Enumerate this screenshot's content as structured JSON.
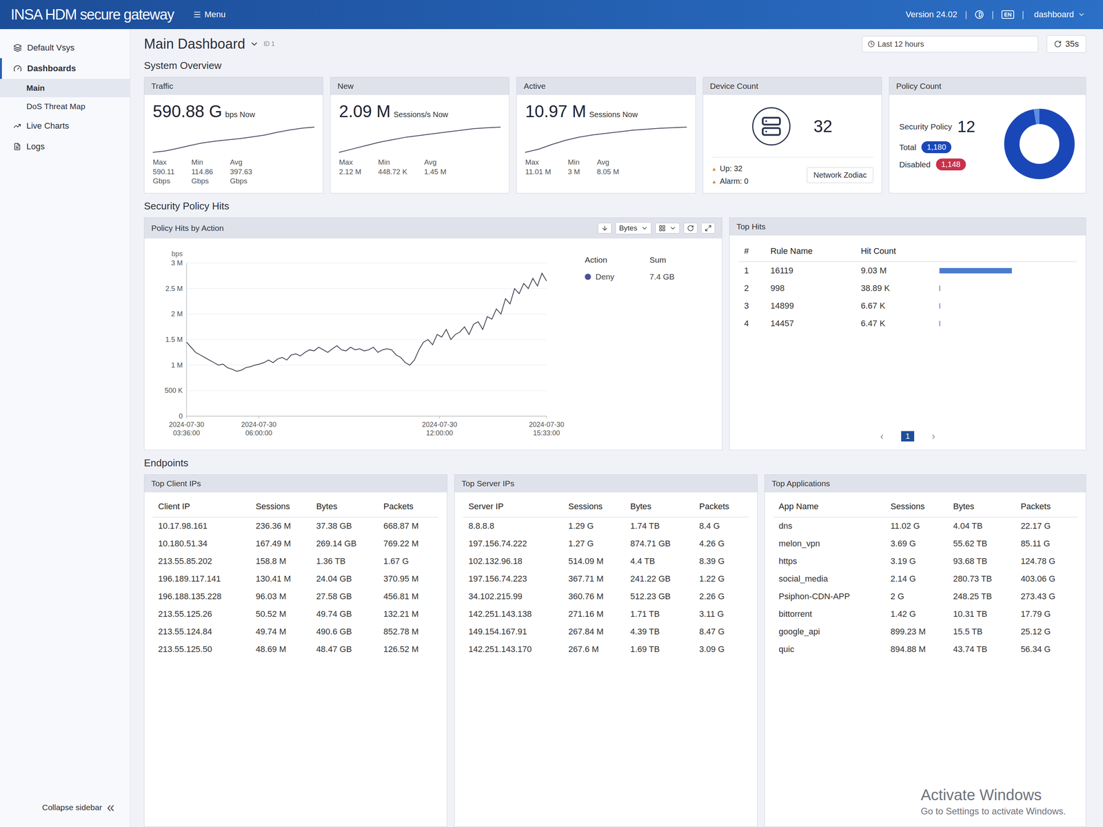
{
  "topbar": {
    "logo": "INSA HDM secure gateway",
    "menu": "Menu",
    "version": "Version 24.02",
    "separator": "|",
    "lang": "EN",
    "user": "dashboard"
  },
  "sidebar": {
    "vsys": "Default Vsys",
    "group": {
      "label": "Dashboards",
      "expanded": true,
      "children": [
        {
          "label": "Main",
          "selected": true
        },
        {
          "label": "DoS Threat Map",
          "selected": false
        }
      ]
    },
    "items": [
      {
        "label": "Live Charts",
        "selected": false
      },
      {
        "label": "Logs",
        "selected": false
      }
    ],
    "collapse": "Collapse sidebar",
    "collapse_glyph": "«"
  },
  "header": {
    "title": "Main Dashboard",
    "id": "ID 1",
    "time_range": "Last 12 hours",
    "refresh": "35s"
  },
  "overview": {
    "title": "System Overview",
    "cards": [
      {
        "title": "Traffic",
        "value": "590.88 G",
        "unit": "bps Now",
        "series": [
          150,
          175,
          220,
          270,
          315,
          345,
          368,
          390,
          420,
          452,
          500,
          540,
          572,
          590
        ],
        "stats": [
          {
            "label": "Max",
            "value": "590.11",
            "unit": "Gbps"
          },
          {
            "label": "Min",
            "value": "114.86",
            "unit": "Gbps"
          },
          {
            "label": "Avg",
            "value": "397.63",
            "unit": "Gbps"
          }
        ]
      },
      {
        "title": "New",
        "value": "2.09 M",
        "unit": "Sessions/s Now",
        "series": [
          0.6,
          0.8,
          1.0,
          1.2,
          1.35,
          1.5,
          1.6,
          1.7,
          1.8,
          1.9,
          2.0,
          2.05,
          2.09
        ],
        "stats": [
          {
            "label": "Max",
            "value": "2.12 M",
            "unit": ""
          },
          {
            "label": "Min",
            "value": "448.72 K",
            "unit": ""
          },
          {
            "label": "Avg",
            "value": "1.45 M",
            "unit": ""
          }
        ]
      },
      {
        "title": "Active",
        "value": "10.97 M",
        "unit": "Sessions Now",
        "series": [
          3,
          4,
          5.5,
          6.8,
          7.8,
          8.5,
          9,
          9.5,
          10,
          10.3,
          10.6,
          10.8,
          10.97
        ],
        "stats": [
          {
            "label": "Max",
            "value": "11.01 M",
            "unit": ""
          },
          {
            "label": "Min",
            "value": "3 M",
            "unit": ""
          },
          {
            "label": "Avg",
            "value": "8.05 M",
            "unit": ""
          }
        ]
      }
    ],
    "device": {
      "title": "Device Count",
      "count": "32",
      "up": {
        "glyph": "▲",
        "label": "Up: 32"
      },
      "alarm": {
        "glyph": "▲",
        "label": "Alarm: 0"
      },
      "button": "Network Zodiac"
    },
    "policy": {
      "title": "Policy Count",
      "label": "Security Policy",
      "count": "12",
      "total": {
        "label": "Total",
        "value": "1,180"
      },
      "disabled": {
        "label": "Disabled",
        "value": "1,148"
      },
      "donut": [
        {
          "value": 1148,
          "color": "#1a47b8"
        },
        {
          "value": 32,
          "color": "#5b8fe6"
        }
      ]
    }
  },
  "hits": {
    "title": "Security Policy Hits",
    "chart": {
      "title": "Policy Hits by Action",
      "toolbar": {
        "metric": "Bytes"
      },
      "unit": "bps",
      "y_ticks": [
        {
          "label": "0",
          "value": 0
        },
        {
          "label": "500 K",
          "value": 0.5
        },
        {
          "label": "1 M",
          "value": 1
        },
        {
          "label": "1.5 M",
          "value": 1.5
        },
        {
          "label": "2 M",
          "value": 2
        },
        {
          "label": "2.5 M",
          "value": 2.5
        },
        {
          "label": "3 M",
          "value": 3
        }
      ],
      "x_ticks": [
        {
          "date": "2024-07-30",
          "time": "03:36:00",
          "t": 0
        },
        {
          "date": "2024-07-30",
          "time": "06:00:00",
          "t": 144
        },
        {
          "date": "2024-07-30",
          "time": "12:00:00",
          "t": 504
        },
        {
          "date": "2024-07-30",
          "time": "15:33:00",
          "t": 717
        }
      ],
      "legend": {
        "columns": [
          "Action",
          "Sum"
        ]
      },
      "series": [
        {
          "name": "Deny",
          "sum": "7.4 GB",
          "color": "#4a4f9a",
          "values": [
            1.45,
            1.35,
            1.25,
            1.2,
            1.15,
            1.1,
            1.05,
            1.0,
            1.02,
            0.95,
            0.92,
            0.88,
            0.9,
            0.95,
            0.97,
            1.0,
            1.02,
            1.05,
            1.1,
            1.05,
            1.12,
            1.15,
            1.1,
            1.2,
            1.22,
            1.18,
            1.25,
            1.3,
            1.28,
            1.35,
            1.3,
            1.25,
            1.32,
            1.38,
            1.3,
            1.28,
            1.35,
            1.3,
            1.32,
            1.28,
            1.3,
            1.35,
            1.25,
            1.3,
            1.32,
            1.3,
            1.2,
            1.15,
            1.05,
            1.0,
            1.1,
            1.3,
            1.45,
            1.5,
            1.4,
            1.6,
            1.55,
            1.7,
            1.5,
            1.6,
            1.65,
            1.75,
            1.6,
            1.8,
            1.85,
            1.7,
            1.95,
            1.9,
            2.1,
            2.0,
            2.3,
            2.2,
            2.5,
            2.4,
            2.6,
            2.5,
            2.7,
            2.55,
            2.8,
            2.65
          ]
        }
      ]
    },
    "top_hits": {
      "title": "Top Hits",
      "columns": [
        "#",
        "Rule Name",
        "Hit Count"
      ],
      "rows": [
        {
          "rank": "1",
          "rule": "16119",
          "count": "9.03 M",
          "level": 1.0
        },
        {
          "rank": "2",
          "rule": "998",
          "count": "38.89 K",
          "level": 0.0043
        },
        {
          "rank": "3",
          "rule": "14899",
          "count": "6.67 K",
          "level": 0.0007
        },
        {
          "rank": "4",
          "rule": "14457",
          "count": "6.47 K",
          "level": 0.0007
        }
      ],
      "pagination": {
        "prev": "‹",
        "next": "›",
        "pages": [
          {
            "label": "1",
            "selected": true
          }
        ]
      }
    }
  },
  "endpoints": {
    "title": "Endpoints",
    "tables": [
      {
        "title": "Top Client IPs",
        "columns": [
          "Client IP",
          "Sessions",
          "Bytes",
          "Packets"
        ],
        "rows": [
          [
            "10.17.98.161",
            "236.36 M",
            "37.38 GB",
            "668.87 M"
          ],
          [
            "10.180.51.34",
            "167.49 M",
            "269.14 GB",
            "769.22 M"
          ],
          [
            "213.55.85.202",
            "158.8 M",
            "1.36 TB",
            "1.67 G"
          ],
          [
            "196.189.117.141",
            "130.41 M",
            "24.04 GB",
            "370.95 M"
          ],
          [
            "196.188.135.228",
            "96.03 M",
            "27.58 GB",
            "456.81 M"
          ],
          [
            "213.55.125.26",
            "50.52 M",
            "49.74 GB",
            "132.21 M"
          ],
          [
            "213.55.124.84",
            "49.74 M",
            "490.6 GB",
            "852.78 M"
          ],
          [
            "213.55.125.50",
            "48.69 M",
            "48.47 GB",
            "126.52 M"
          ]
        ]
      },
      {
        "title": "Top Server IPs",
        "columns": [
          "Server IP",
          "Sessions",
          "Bytes",
          "Packets"
        ],
        "rows": [
          [
            "8.8.8.8",
            "1.29 G",
            "1.74 TB",
            "8.4 G"
          ],
          [
            "197.156.74.222",
            "1.27 G",
            "874.71 GB",
            "4.26 G"
          ],
          [
            "102.132.96.18",
            "514.09 M",
            "4.4 TB",
            "8.39 G"
          ],
          [
            "197.156.74.223",
            "367.71 M",
            "241.22 GB",
            "1.22 G"
          ],
          [
            "34.102.215.99",
            "360.76 M",
            "512.23 GB",
            "2.26 G"
          ],
          [
            "142.251.143.138",
            "271.16 M",
            "1.71 TB",
            "3.11 G"
          ],
          [
            "149.154.167.91",
            "267.84 M",
            "4.39 TB",
            "8.47 G"
          ],
          [
            "142.251.143.170",
            "267.6 M",
            "1.69 TB",
            "3.09 G"
          ]
        ]
      },
      {
        "title": "Top Applications",
        "columns": [
          "App Name",
          "Sessions",
          "Bytes",
          "Packets"
        ],
        "rows": [
          [
            "dns",
            "11.02 G",
            "4.04 TB",
            "22.17 G"
          ],
          [
            "melon_vpn",
            "3.69 G",
            "55.62 TB",
            "85.11 G"
          ],
          [
            "https",
            "3.19 G",
            "93.68 TB",
            "124.78 G"
          ],
          [
            "social_media",
            "2.14 G",
            "280.73 TB",
            "403.06 G"
          ],
          [
            "Psiphon-CDN-APP",
            "2 G",
            "248.25 TB",
            "273.43 G"
          ],
          [
            "bittorrent",
            "1.42 G",
            "10.31 TB",
            "17.79 G"
          ],
          [
            "google_api",
            "899.23 M",
            "15.5 TB",
            "25.12 G"
          ],
          [
            "quic",
            "894.88 M",
            "43.74 TB",
            "56.34 G"
          ]
        ]
      }
    ]
  },
  "watermark": {
    "title": "Activate Windows",
    "subtitle": "Go to Settings to activate Windows."
  }
}
